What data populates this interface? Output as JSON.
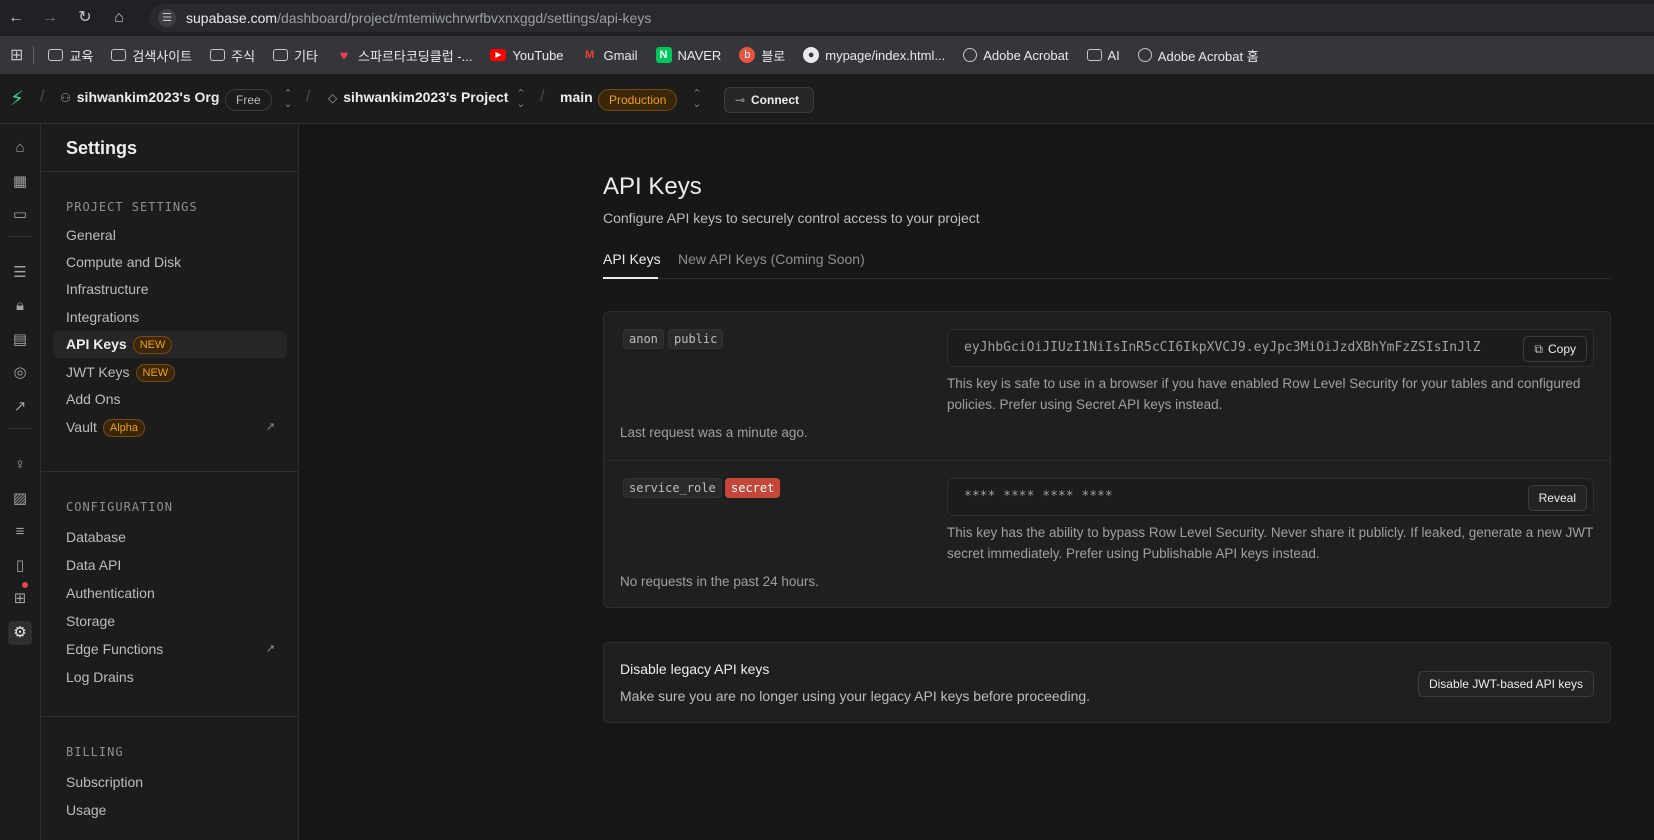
{
  "browser": {
    "url_host": "supabase.com",
    "url_path": "/dashboard/project/mtemiwchrwrfbvxnxggd/settings/api-keys",
    "bookmarks": [
      {
        "label": "교육",
        "icon": "folder-icon"
      },
      {
        "label": "검색사이트",
        "icon": "folder-icon"
      },
      {
        "label": "주식",
        "icon": "folder-icon"
      },
      {
        "label": "기타",
        "icon": "folder-icon"
      },
      {
        "label": "스파르타코딩클럽 -...",
        "icon": "heart-icon"
      },
      {
        "label": "YouTube",
        "icon": "youtube-icon"
      },
      {
        "label": "Gmail",
        "icon": "gmail-icon"
      },
      {
        "label": "NAVER",
        "icon": "naver-icon"
      },
      {
        "label": "블로",
        "icon": "blog-icon"
      },
      {
        "label": "mypage/index.html...",
        "icon": "github-icon"
      },
      {
        "label": "Adobe Acrobat",
        "icon": "globe-icon"
      },
      {
        "label": "AI",
        "icon": "folder-icon"
      },
      {
        "label": "Adobe Acrobat 홈",
        "icon": "globe-icon"
      }
    ]
  },
  "header": {
    "org_name": "sihwankim2023's Org",
    "org_plan": "Free",
    "project_name": "sihwankim2023's Project",
    "branch": "main",
    "branch_env": "Production",
    "connect_label": "Connect"
  },
  "sidebar": {
    "title": "Settings",
    "project_section": "PROJECT SETTINGS",
    "project_items": [
      {
        "label": "General"
      },
      {
        "label": "Compute and Disk"
      },
      {
        "label": "Infrastructure"
      },
      {
        "label": "Integrations"
      },
      {
        "label": "API Keys",
        "badge": "NEW"
      },
      {
        "label": "JWT Keys",
        "badge": "NEW"
      },
      {
        "label": "Add Ons"
      },
      {
        "label": "Vault",
        "badge": "Alpha"
      }
    ],
    "config_section": "CONFIGURATION",
    "config_items": [
      {
        "label": "Database"
      },
      {
        "label": "Data API"
      },
      {
        "label": "Authentication"
      },
      {
        "label": "Storage"
      },
      {
        "label": "Edge Functions"
      },
      {
        "label": "Log Drains"
      }
    ],
    "billing_section": "BILLING",
    "billing_items": [
      {
        "label": "Subscription"
      },
      {
        "label": "Usage"
      }
    ]
  },
  "main": {
    "title": "API Keys",
    "description": "Configure API keys to securely control access to your project",
    "tabs": [
      {
        "label": "API Keys"
      },
      {
        "label": "New API Keys (Coming Soon)"
      }
    ],
    "keys": [
      {
        "tag1": "anon",
        "tag2": "public",
        "value": "eyJhbGciOiJIUzI1NiIsInR5cCI6IkpXVCJ9.eyJpc3MiOiJzdXBhYmFzZSIsInJlZ",
        "button": "Copy",
        "note": "This key is safe to use in a browser if you have enabled Row Level Security for your tables and configured policies. Prefer using Secret API keys instead.",
        "last_request": "Last request was a minute ago."
      },
      {
        "tag1": "service_role",
        "tag2": "secret",
        "value": "**** **** **** ****",
        "button": "Reveal",
        "note": "This key has the ability to bypass Row Level Security. Never share it publicly. If leaked, generate a new JWT secret immediately. Prefer using Publishable API keys instead.",
        "last_request": "No requests in the past 24 hours."
      }
    ],
    "legacy": {
      "title": "Disable legacy API keys",
      "description": "Make sure you are no longer using your legacy API keys before proceeding.",
      "button": "Disable JWT-based API keys"
    }
  }
}
